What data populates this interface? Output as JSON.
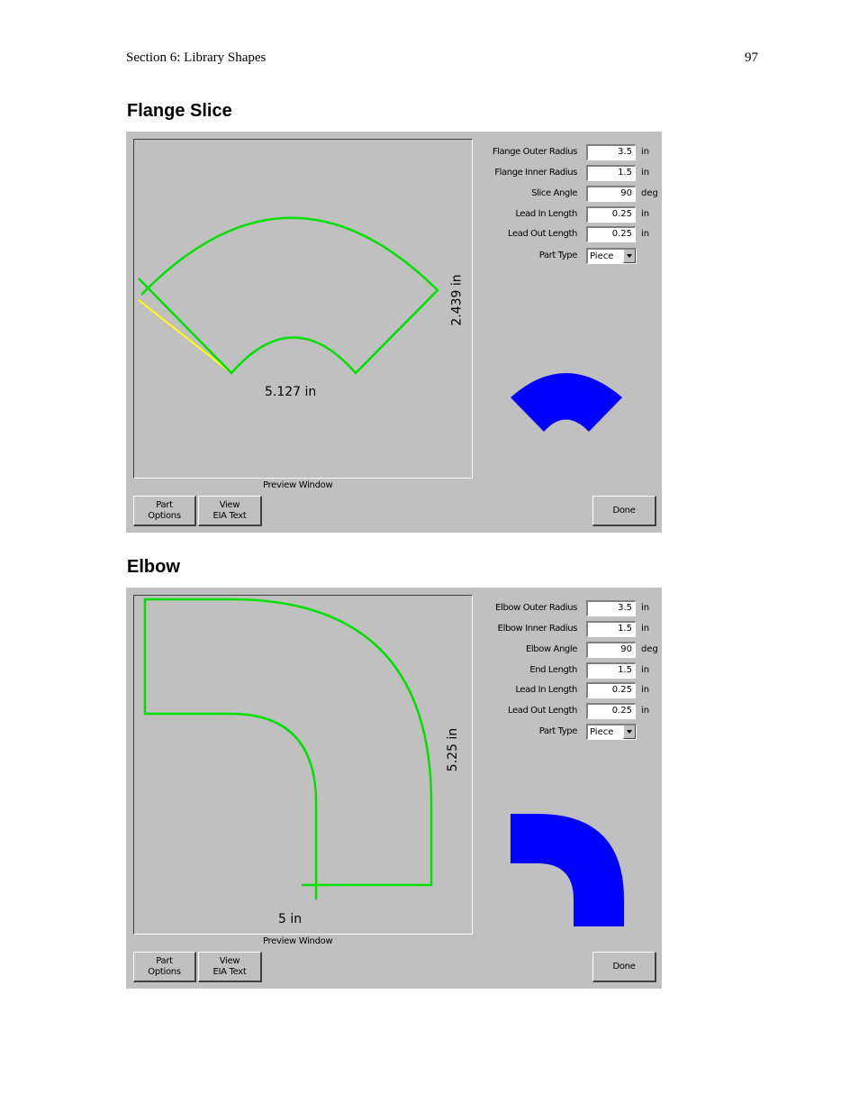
{
  "header": {
    "section": "Section 6: Library Shapes",
    "page_number": "97"
  },
  "flange": {
    "title": "Flange Slice",
    "dim_width": "5.127 in",
    "dim_height": "2.439 in",
    "preview_label": "Preview Window",
    "params": [
      {
        "label": "Flange Outer Radius",
        "value": "3.5",
        "unit": "in"
      },
      {
        "label": "Flange Inner Radius",
        "value": "1.5",
        "unit": "in"
      },
      {
        "label": "Slice Angle",
        "value": "90",
        "unit": "deg"
      },
      {
        "label": "Lead In Length",
        "value": "0.25",
        "unit": "in"
      },
      {
        "label": "Lead Out Length",
        "value": "0.25",
        "unit": "in"
      }
    ],
    "part_type": {
      "label": "Part Type",
      "value": "Piece"
    },
    "buttons": {
      "part_options_1": "Part",
      "part_options_2": "Options",
      "view_eia_1": "View",
      "view_eia_2": "EIA Text",
      "done": "Done"
    },
    "colors": {
      "path": "#00e000",
      "lead": "#ffff00",
      "fill": "#0000ff"
    }
  },
  "elbow": {
    "title": "Elbow",
    "dim_width": "5 in",
    "dim_height": "5.25 in",
    "preview_label": "Preview Window",
    "params": [
      {
        "label": "Elbow Outer Radius",
        "value": "3.5",
        "unit": "in"
      },
      {
        "label": "Elbow Inner Radius",
        "value": "1.5",
        "unit": "in"
      },
      {
        "label": "Elbow Angle",
        "value": "90",
        "unit": "deg"
      },
      {
        "label": "End Length",
        "value": "1.5",
        "unit": "in"
      },
      {
        "label": "Lead In Length",
        "value": "0.25",
        "unit": "in"
      },
      {
        "label": "Lead Out Length",
        "value": "0.25",
        "unit": "in"
      }
    ],
    "part_type": {
      "label": "Part Type",
      "value": "Piece"
    },
    "buttons": {
      "part_options_1": "Part",
      "part_options_2": "Options",
      "view_eia_1": "View",
      "view_eia_2": "EIA Text",
      "done": "Done"
    },
    "colors": {
      "path": "#00e000",
      "fill": "#0000ff"
    }
  }
}
